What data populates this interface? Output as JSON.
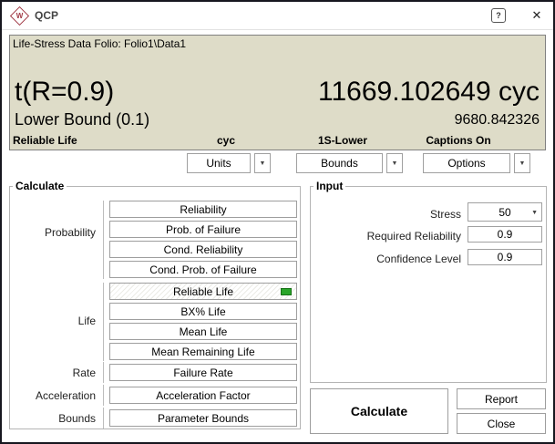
{
  "window": {
    "title": "QCP",
    "logo_letter": "W"
  },
  "titlebar": {
    "help_glyph": "?",
    "close_glyph": "✕"
  },
  "results": {
    "header": "Life-Stress Data Folio: Folio1\\Data1",
    "metric_label": "t(R=0.9)",
    "metric_value": "11669.102649 cyc",
    "bound_label": "Lower Bound (0.1)",
    "bound_value": "9680.842326",
    "caption_left": "Reliable Life",
    "caption_units": "cyc",
    "caption_bounds": "1S-Lower",
    "caption_options": "Captions On"
  },
  "toolbar": {
    "units": "Units",
    "bounds": "Bounds",
    "options": "Options",
    "dropdown_glyph": "▼"
  },
  "calc": {
    "title": "Calculate",
    "sections": [
      {
        "label": "Probability",
        "buttons": [
          "Reliability",
          "Prob. of Failure",
          "Cond. Reliability",
          "Cond. Prob. of Failure"
        ]
      },
      {
        "label": "Life",
        "buttons": [
          "Reliable Life",
          "BX% Life",
          "Mean Life",
          "Mean Remaining Life"
        ],
        "selected": "Reliable Life"
      },
      {
        "label": "Rate",
        "buttons": [
          "Failure Rate"
        ]
      },
      {
        "label": "Acceleration",
        "buttons": [
          "Acceleration Factor"
        ]
      },
      {
        "label": "Bounds",
        "buttons": [
          "Parameter Bounds"
        ]
      }
    ]
  },
  "input": {
    "title": "Input",
    "fields": [
      {
        "label": "Stress",
        "value": "50"
      },
      {
        "label": "Required Reliability",
        "value": "0.9"
      },
      {
        "label": "Confidence Level",
        "value": "0.9"
      }
    ]
  },
  "actions": {
    "calculate": "Calculate",
    "report": "Report",
    "close": "Close"
  },
  "colors": {
    "panel_bg": "#dedcc8",
    "selected_indicator": "#2aa52a",
    "logo_red": "#a23b47"
  }
}
